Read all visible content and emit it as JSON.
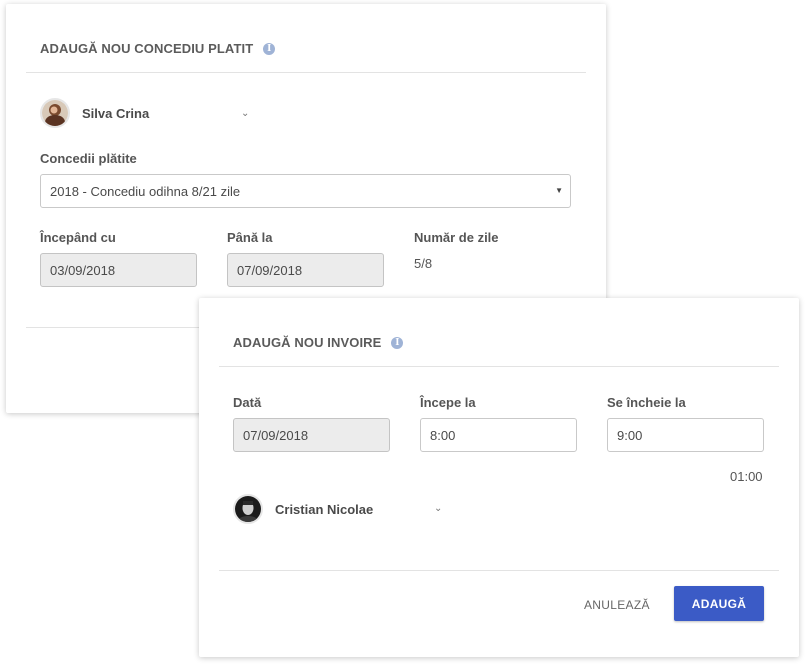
{
  "paid_leave": {
    "title": "ADAUGĂ NOU CONCEDIU PLATIT",
    "employee": {
      "name": "Silva Crina"
    },
    "leave_type_label": "Concedii plătite",
    "leave_type_value": "2018 - Concediu odihna 8/21 zile",
    "start_label": "Începând cu",
    "start_value": "03/09/2018",
    "end_label": "Până la",
    "end_value": "07/09/2018",
    "days_label": "Număr de zile",
    "days_value": "5/8"
  },
  "time_off": {
    "title": "ADAUGĂ NOU INVOIRE",
    "date_label": "Dată",
    "date_value": "07/09/2018",
    "start_label": "Începe la",
    "start_value": "8:00",
    "end_label": "Se încheie la",
    "end_value": "9:00",
    "duration": "01:00",
    "employee": {
      "name": "Cristian Nicolae"
    },
    "cancel_label": "ANULEAZĂ",
    "submit_label": "ADAUGĂ"
  },
  "colors": {
    "accent": "#3b5bc6",
    "info_icon": "#9fb3d6",
    "disabled_field": "#ececec"
  },
  "icons": [
    "info-icon",
    "chevron-down-icon",
    "select-arrow-icon",
    "avatar"
  ]
}
